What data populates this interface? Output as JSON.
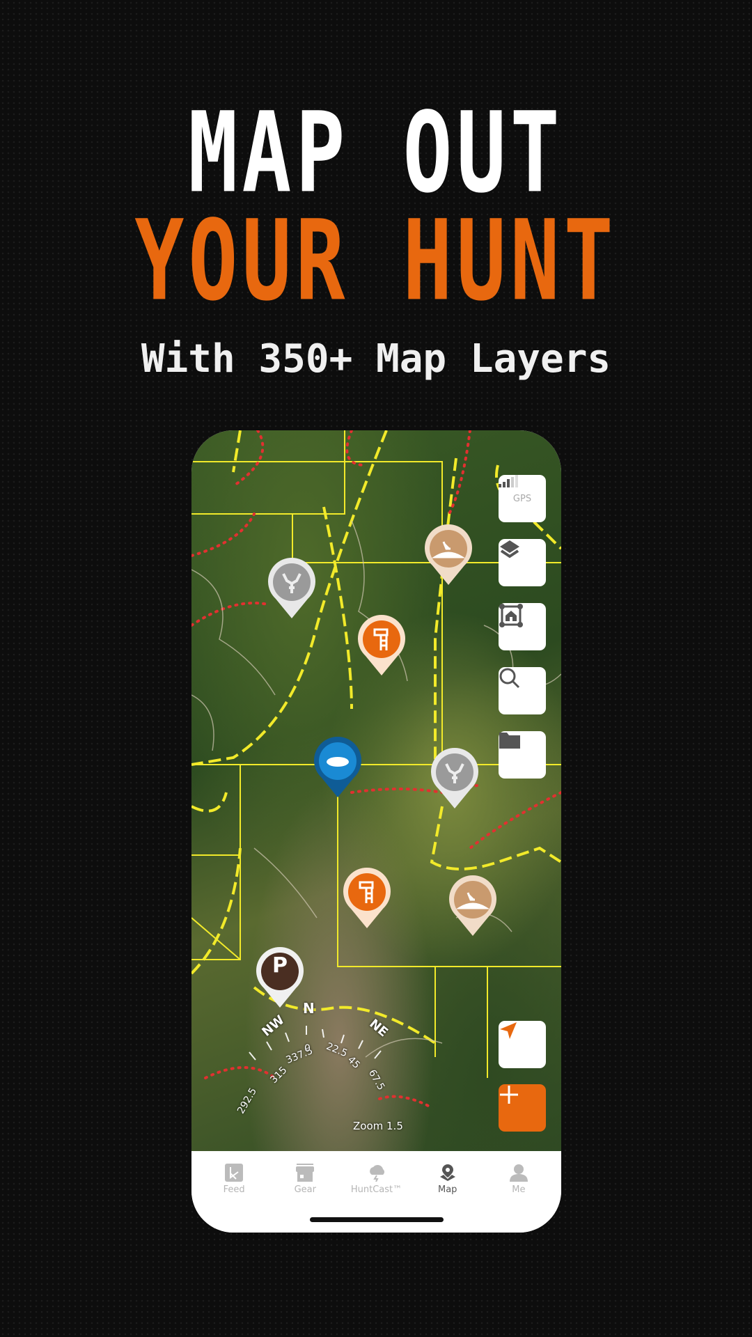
{
  "headline": {
    "line1": "MAP OUT",
    "line2": "YOUR HUNT",
    "subtitle": "With 350+ Map Layers"
  },
  "colors": {
    "accent": "#e8680f",
    "boundary": "#f2ea2a",
    "trail": "#e23030",
    "blue_pin": "#1a7dc4",
    "tan_pin": "#d4a57a",
    "gray_pin": "#9a9a9a",
    "parking_pin": "#4a2e22"
  },
  "map": {
    "controls": {
      "gps_label": "GPS",
      "layers": "layers-icon",
      "property": "property-boundary-icon",
      "search": "search-icon",
      "folder": "folder-icon",
      "locate": "location-arrow-icon",
      "add": "plus-icon"
    },
    "compass": {
      "labels": [
        "NW",
        "N",
        "NE"
      ],
      "degrees": [
        "292.5",
        "315",
        "337.5",
        "0",
        "22.5",
        "45",
        "67.5"
      ],
      "zoom_label": "Zoom 1.5"
    },
    "pins": [
      "deer",
      "bedding",
      "treestand",
      "water",
      "deer",
      "treestand",
      "bedding",
      "parking"
    ],
    "parking_letter": "P"
  },
  "nav": {
    "tabs": [
      {
        "label": "Feed"
      },
      {
        "label": "Gear"
      },
      {
        "label": "HuntCast™"
      },
      {
        "label": "Map",
        "active": true
      },
      {
        "label": "Me"
      }
    ]
  }
}
